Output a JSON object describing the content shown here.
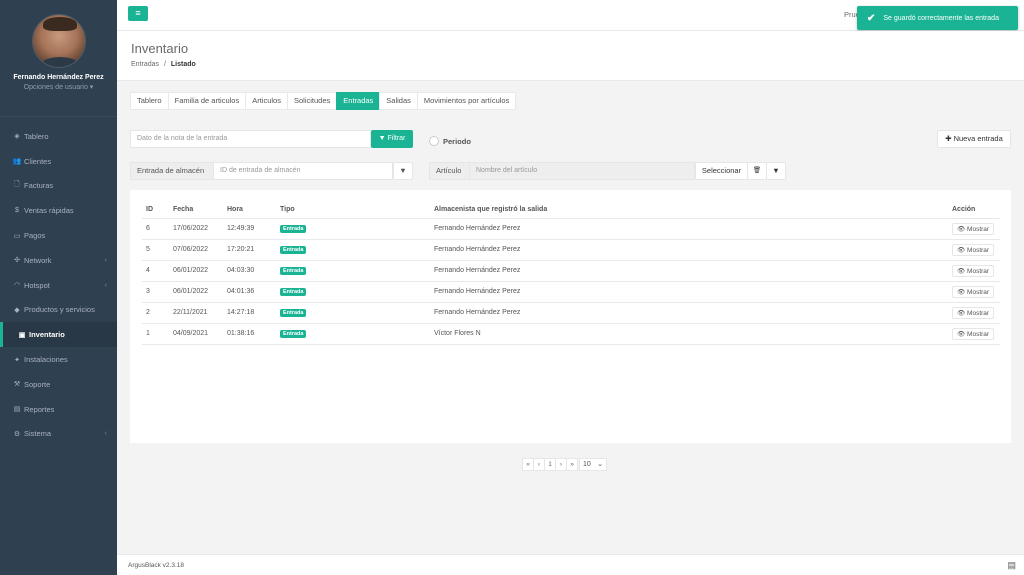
{
  "sidebar": {
    "user_name": "Fernando Hernández Perez",
    "user_options": "Opciones de usuario ▾",
    "items": [
      {
        "label": "Tablero",
        "icon": "dashboard-icon",
        "glyph": "◈",
        "chevron": false
      },
      {
        "label": "Clientes",
        "icon": "users-icon",
        "glyph": "👥",
        "chevron": false
      },
      {
        "label": "Facturas",
        "icon": "file-icon",
        "glyph": "🗋",
        "chevron": false
      },
      {
        "label": "Ventas rápidas",
        "icon": "dollar-icon",
        "glyph": "$",
        "chevron": false
      },
      {
        "label": "Pagos",
        "icon": "money-icon",
        "glyph": "▭",
        "chevron": false
      },
      {
        "label": "Network",
        "icon": "network-icon",
        "glyph": "✣",
        "chevron": true
      },
      {
        "label": "Hotspot",
        "icon": "wifi-icon",
        "glyph": "◠",
        "chevron": true
      },
      {
        "label": "Productos y servicios",
        "icon": "tags-icon",
        "glyph": "◆",
        "chevron": false
      },
      {
        "label": "Inventario",
        "icon": "cubes-icon",
        "glyph": "▣",
        "chevron": false,
        "active": true
      },
      {
        "label": "Instalaciones",
        "icon": "tools-icon",
        "glyph": "✦",
        "chevron": false
      },
      {
        "label": "Soporte",
        "icon": "wrench-icon",
        "glyph": "⚒",
        "chevron": false
      },
      {
        "label": "Reportes",
        "icon": "report-icon",
        "glyph": "▤",
        "chevron": false
      },
      {
        "label": "Sistema",
        "icon": "cogs-icon",
        "glyph": "⚙",
        "chevron": true
      }
    ]
  },
  "topbar": {
    "menu_glyph": "≡",
    "user_short": "Prue"
  },
  "toast": {
    "message": "Se guardó correctamente las entrada"
  },
  "heading": {
    "title": "Inventario",
    "crumb_1": "Entradas",
    "crumb_sep": "/",
    "crumb_2": "Listado"
  },
  "tabs": [
    "Tablero",
    "Familia de articulos",
    "Articulos",
    "Solicitudes",
    "Entradas",
    "Salidas",
    "Movimientos por artículos"
  ],
  "active_tab": 4,
  "filters": {
    "note_placeholder": "Dato de la nota de la entrada",
    "filter_button": "▼ Filtrar",
    "period_label": "Periodo",
    "new_entry_button": "✚ Nueva entrada",
    "warehouse_addon": "Entrada de almacén",
    "warehouse_placeholder": "ID de entrada de almacén",
    "article_addon": "Artículo",
    "article_placeholder": "Nombre del artículo",
    "select_button": "Seleccionar",
    "trash_glyph": "🗑",
    "funnel_glyph": "▼"
  },
  "table": {
    "headers": [
      "ID",
      "Fecha",
      "Hora",
      "Tipo",
      "Almacenista que registró la salida",
      "Acción"
    ],
    "rows": [
      {
        "id": "6",
        "fecha": "17/06/2022",
        "hora": "12:49:39",
        "tipo": "Entrada",
        "almacenista": "Fernando Hernández Perez",
        "accion": "👁 Mostrar"
      },
      {
        "id": "5",
        "fecha": "07/06/2022",
        "hora": "17:20:21",
        "tipo": "Entrada",
        "almacenista": "Fernando Hernández Perez",
        "accion": "👁 Mostrar"
      },
      {
        "id": "4",
        "fecha": "06/01/2022",
        "hora": "04:03:30",
        "tipo": "Entrada",
        "almacenista": "Fernando Hernández Perez",
        "accion": "👁 Mostrar"
      },
      {
        "id": "3",
        "fecha": "06/01/2022",
        "hora": "04:01:36",
        "tipo": "Entrada",
        "almacenista": "Fernando Hernández Perez",
        "accion": "👁 Mostrar"
      },
      {
        "id": "2",
        "fecha": "22/11/2021",
        "hora": "14:27:18",
        "tipo": "Entrada",
        "almacenista": "Fernando Hernández Perez",
        "accion": "👁 Mostrar"
      },
      {
        "id": "1",
        "fecha": "04/09/2021",
        "hora": "01:38:16",
        "tipo": "Entrada",
        "almacenista": "Víctor Flores N",
        "accion": "👁 Mostrar"
      }
    ]
  },
  "pagination": {
    "first": "«",
    "prev": "‹",
    "page": "1",
    "next": "›",
    "last": "»",
    "page_size": "10"
  },
  "footer": {
    "version": "ArgusBlack v2.3.18",
    "icon_glyph": "▤"
  },
  "colors": {
    "accent": "#1ab394",
    "sidebar": "#2f4050"
  }
}
